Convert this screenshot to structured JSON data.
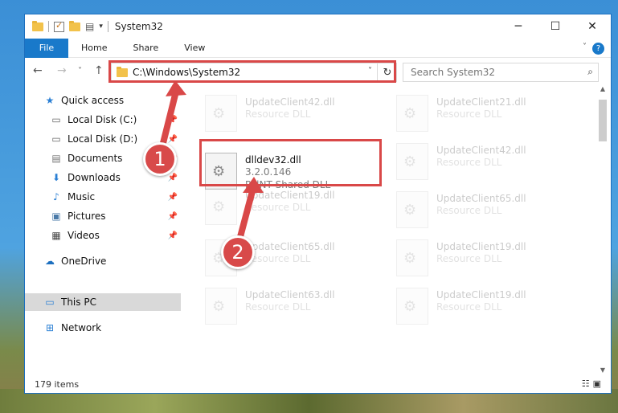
{
  "window": {
    "title": "System32",
    "controls": {
      "minimize": "─",
      "maximize": "☐",
      "close": "✕"
    }
  },
  "ribbon": {
    "tabs": [
      "File",
      "Home",
      "Share",
      "View"
    ],
    "help": "?"
  },
  "navigation": {
    "back": "←",
    "forward": "→",
    "recent": "˅",
    "up": "↑",
    "address": "C:\\Windows\\System32",
    "refresh": "↻",
    "search_placeholder": "Search System32"
  },
  "sidebar": {
    "items": [
      {
        "label": "Quick access",
        "icon": "star-icon",
        "pinned": false
      },
      {
        "label": "Local Disk (C:)",
        "icon": "drive-icon",
        "pinned": true
      },
      {
        "label": "Local Disk (D:)",
        "icon": "drive-icon",
        "pinned": true
      },
      {
        "label": "Documents",
        "icon": "documents-icon",
        "pinned": true
      },
      {
        "label": "Downloads",
        "icon": "download-icon",
        "pinned": true
      },
      {
        "label": "Music",
        "icon": "music-icon",
        "pinned": true
      },
      {
        "label": "Pictures",
        "icon": "pictures-icon",
        "pinned": true
      },
      {
        "label": "Videos",
        "icon": "videos-icon",
        "pinned": true
      },
      {
        "label": "OneDrive",
        "icon": "cloud-icon",
        "pinned": false
      },
      {
        "label": "This PC",
        "icon": "computer-icon",
        "pinned": false,
        "selected": true
      },
      {
        "label": "Network",
        "icon": "network-icon",
        "pinned": false
      }
    ]
  },
  "files": {
    "highlighted": {
      "name": "dlldev32.dll",
      "version": "3.2.0.146",
      "description": "PolNT Shared DLL"
    },
    "left_column": [
      {
        "name": "UpdateClient42.dll",
        "type": "Resource DLL"
      },
      {
        "name": "UpdateClient19.dll",
        "type": "Resource DLL"
      },
      {
        "name": "UpdateClient65.dll",
        "type": "Resource DLL"
      },
      {
        "name": "UpdateClient63.dll",
        "type": "Resource DLL"
      }
    ],
    "right_column": [
      {
        "name": "UpdateClient21.dll",
        "type": "Resource DLL"
      },
      {
        "name": "UpdateClient42.dll",
        "type": "Resource DLL"
      },
      {
        "name": "UpdateClient65.dll",
        "type": "Resource DLL"
      },
      {
        "name": "UpdateClient19.dll",
        "type": "Resource DLL"
      },
      {
        "name": "UpdateClient19.dll",
        "type": "Resource DLL"
      }
    ]
  },
  "status": {
    "item_count": "179 items"
  },
  "annotations": {
    "step1": "1",
    "step2": "2",
    "color": "#d94848"
  }
}
